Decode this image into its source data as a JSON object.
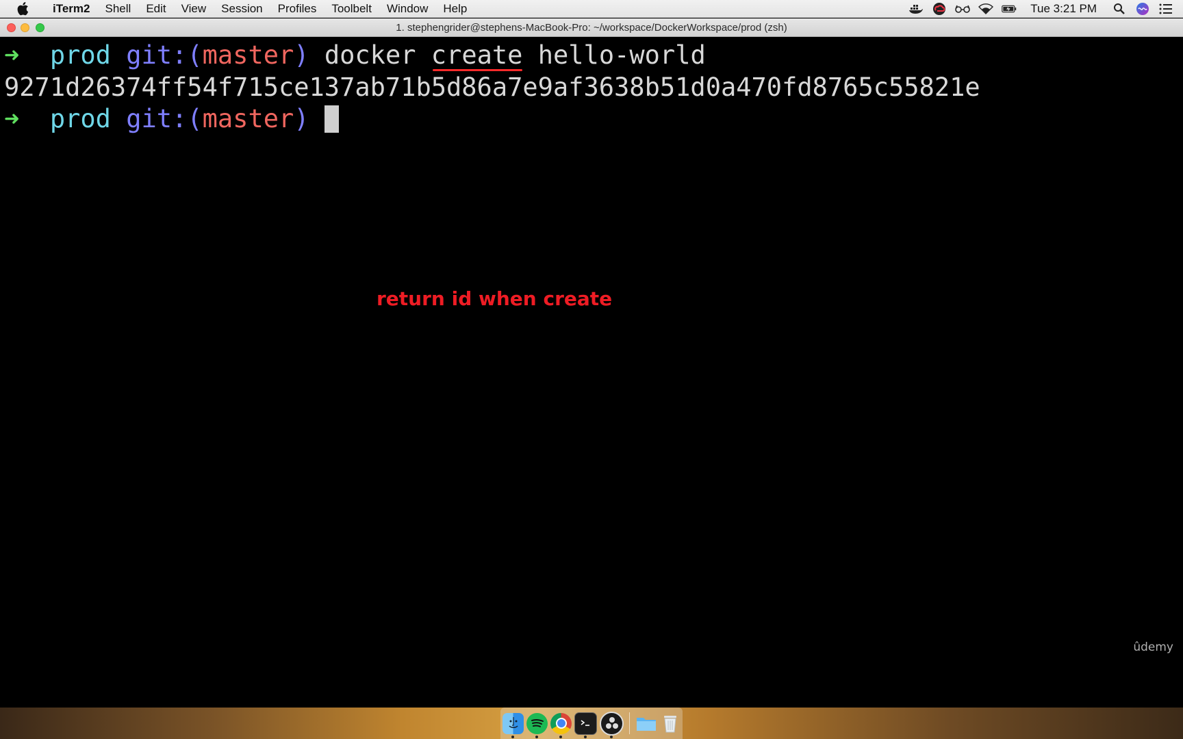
{
  "menubar": {
    "app_name": "iTerm2",
    "items": [
      "Shell",
      "Edit",
      "View",
      "Session",
      "Profiles",
      "Toolbelt",
      "Window",
      "Help"
    ],
    "clock": "Tue 3:21 PM"
  },
  "window": {
    "title": "1. stephengrider@stephens-MacBook-Pro: ~/workspace/DockerWorkspace/prod (zsh)"
  },
  "terminal": {
    "line1": {
      "arrow": "➜",
      "dir": "prod",
      "git_prefix": "git:(",
      "branch": "master",
      "git_suffix": ")",
      "cmd_before": "docker",
      "cmd_highlight": "create",
      "cmd_after": "hello-world"
    },
    "line2": {
      "output": "9271d26374ff54f715ce137ab71b5d86a7e9af3638b51d0a470fd8765c55821e"
    },
    "line3": {
      "arrow": "➜",
      "dir": "prod",
      "git_prefix": "git:(",
      "branch": "master",
      "git_suffix": ")"
    }
  },
  "annotation": "return id when create",
  "watermark": "ûdemy",
  "colors": {
    "arrow": "#5fdf5f",
    "dir": "#6fd7e8",
    "git": "#7f7fff",
    "branch": "#f0665f",
    "annotation": "#ee1c24"
  },
  "status_icons": [
    "docker-icon",
    "creative-cloud-icon",
    "glasses-icon",
    "wifi-icon",
    "battery-icon",
    "spotlight-icon",
    "siri-icon",
    "notification-center-icon"
  ],
  "dock_icons": [
    "finder-icon",
    "spotify-icon",
    "chrome-icon",
    "terminal-icon",
    "obs-icon",
    "downloads-folder-icon",
    "trash-icon"
  ]
}
